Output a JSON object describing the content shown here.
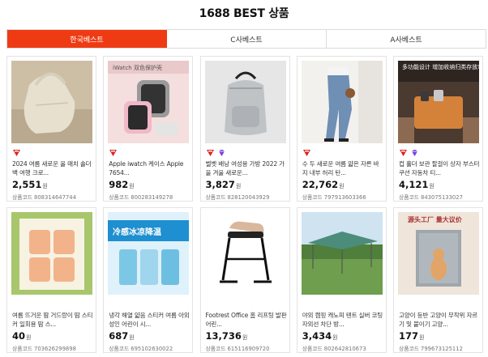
{
  "page": {
    "title": "1688 BEST 상품"
  },
  "tabs": [
    {
      "label": "한국베스트",
      "active": true
    },
    {
      "label": "C사베스트",
      "active": false
    },
    {
      "label": "A사베스트",
      "active": false
    }
  ],
  "products": [
    {
      "name": "2024 여름 새로운 올 매치 숄더백 여행 크로...",
      "price": "2,551",
      "currency": "원",
      "code_label": "상품코드",
      "code": "808314647744",
      "badges": [
        "brand-icon"
      ],
      "image_text": ""
    },
    {
      "name": "Apple iwatch 케이스 Apple 7654...",
      "price": "982",
      "currency": "원",
      "code_label": "상품코드",
      "code": "800283149278",
      "badges": [
        "brand-icon"
      ],
      "image_text": "iWatch 双色保护壳"
    },
    {
      "name": "벨벳 배낭 여성용 가방 2022 가을 겨울 새로운...",
      "price": "3,827",
      "currency": "원",
      "code_label": "상품코드",
      "code": "828120043929",
      "badges": [
        "brand-icon",
        "gem-icon"
      ],
      "image_text": ""
    },
    {
      "name": "수 두 새로운 여름 얇은 자른 바지 내부 허리 탄...",
      "price": "22,762",
      "currency": "원",
      "code_label": "상품코드",
      "code": "797913603366",
      "badges": [
        "brand-icon"
      ],
      "image_text": ""
    },
    {
      "name": "컵 홀더 보관 팔걸이 상자 부스터 쿠션 자동차 티...",
      "price": "4,121",
      "currency": "원",
      "code_label": "상품코드",
      "code": "843075133027",
      "badges": [
        "brand-icon",
        "gem-icon"
      ],
      "image_text": "多功能设计 增加收纳归类存放功能"
    },
    {
      "name": "여름 뜨거운 땀 거드랑이 땀 스티커 일회용 땀 스...",
      "price": "40",
      "currency": "원",
      "code_label": "상품코드",
      "code": "703626299898",
      "badges": [],
      "image_text": ""
    },
    {
      "name": "냉각 해열 얇음 스티커 여름 아외 성인 어린이 시...",
      "price": "687",
      "currency": "원",
      "code_label": "상품코드",
      "code": "695102630022",
      "badges": [],
      "image_text": "冷感冰凉降温"
    },
    {
      "name": "Footrest Office 홈 리프팅 발판 어린...",
      "price": "13,736",
      "currency": "원",
      "code_label": "상품코드",
      "code": "615116909720",
      "badges": [],
      "image_text": ""
    },
    {
      "name": "야외 캠핑 캐노피 텐트 실버 코팅 자외선 차단 방...",
      "price": "3,434",
      "currency": "원",
      "code_label": "상품코드",
      "code": "802642810673",
      "badges": [],
      "image_text": ""
    },
    {
      "name": "고양이 등반 고양이 무작위 자르기 및 붙이기 고양...",
      "price": "177",
      "currency": "원",
      "code_label": "상품코드",
      "code": "799673125112",
      "badges": [],
      "image_text": "源头工厂 量大议价"
    }
  ],
  "colors": {
    "accent": "#ee3b14",
    "brand_badge": "#e02020",
    "gem_badge": "#7b3fe4"
  }
}
